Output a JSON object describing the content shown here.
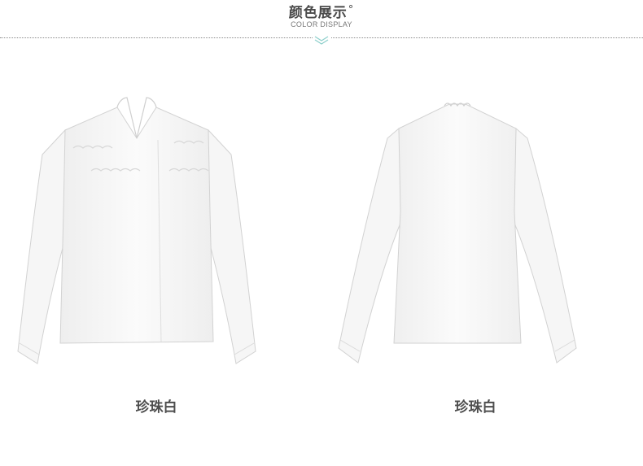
{
  "header": {
    "title": "颜色展示",
    "title_mark": "°",
    "subtitle": "COLOR DISPLAY",
    "divider_icon": "double-chevron-down-icon",
    "accent_color": "#8fd0cc"
  },
  "products": [
    {
      "view": "front",
      "color_name": "珍珠白"
    },
    {
      "view": "back",
      "color_name": "珍珠白"
    }
  ]
}
